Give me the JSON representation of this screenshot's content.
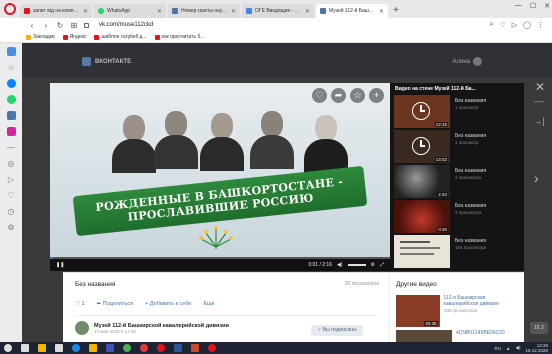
{
  "browser": {
    "tabs": [
      {
        "label": "запит від на комплекто",
        "favicon_color": "#e5131c",
        "active": false
      },
      {
        "label": "WhatsApp",
        "favicon_color": "#25d366",
        "active": false
      },
      {
        "label": "Номер газеты научных г",
        "favicon_color": "#4a76a8",
        "active": false
      },
      {
        "label": "ОГЕ Вводящие - Поиск Г",
        "favicon_color": "#4285f4",
        "active": false
      },
      {
        "label": "Музей 112-й Башкирской",
        "favicon_color": "#4a76a8",
        "active": true
      }
    ],
    "url": "vk.com/muse112ckd",
    "bookmarks": [
      {
        "label": "Закладки",
        "color": "#f4b400"
      },
      {
        "label": "Яндекс",
        "color": "#e5131c"
      },
      {
        "label": "шаблон rozybell д...",
        "color": "#e5131c"
      },
      {
        "label": "как просчитать б...",
        "color": "#e5131c"
      }
    ]
  },
  "vk": {
    "logo_text": "ВКОНТАКТЕ",
    "user_name": "Алина"
  },
  "player": {
    "banner_line1": "РОЖДЕННЫЕ В БАШКОРТОСТАНЕ -",
    "banner_line2": "ПРОСЛАВИВШИЕ РОССИЮ",
    "time": "0:01 / 2:16",
    "progress_fraction": 0.01,
    "tools": [
      "heart-icon",
      "share-icon",
      "star-icon",
      "plus-icon"
    ]
  },
  "playlist": {
    "title": "Видео на стене Музей 112-й Ба...",
    "items": [
      {
        "name": "Без названия",
        "views": "1 просмотр",
        "duration": "12:15",
        "thumb": "#6b3520",
        "clock": true
      },
      {
        "name": "Без названия",
        "views": "1 просмотр",
        "duration": "13:02",
        "thumb": "#3a2a22",
        "clock": true
      },
      {
        "name": "Без названия",
        "views": "2 просмотра",
        "duration": "2:34",
        "thumb": "#222222",
        "clock": false
      },
      {
        "name": "Без названия",
        "views": "2 просмотра",
        "duration": "0:30",
        "thumb": "#7a1c12",
        "clock": false
      },
      {
        "name": "Без названия",
        "views": "104 просмотра",
        "duration": "",
        "thumb": "#e8e4d8",
        "clock": false
      }
    ]
  },
  "info": {
    "title": "Без названия",
    "views": "20 просмотров",
    "like_count": "1",
    "share_label": "Поделиться",
    "add_label": "Добавить к себе",
    "more_label": "Ещё",
    "channel_name": "Музей 112-й Башкирской кавалерийской дивизии",
    "channel_date": "17 мая 2020 в 17:48",
    "subscribe_label": "✓ Вы подписаны"
  },
  "other_videos": {
    "title": "Другие видео",
    "items": [
      {
        "name": "112-я Башкирская кавалерийская дивизия",
        "views": "108 просмотров",
        "duration": "40:38",
        "thumb": "#8a3b26"
      },
      {
        "name": "4CNB01245BE06C20",
        "views": "",
        "duration": "",
        "thumb": "#5b4a3a"
      }
    ]
  },
  "page_badge": "16 2",
  "taskbar": {
    "lang": "RU",
    "time": "13:25",
    "date": "18.12.2020"
  }
}
